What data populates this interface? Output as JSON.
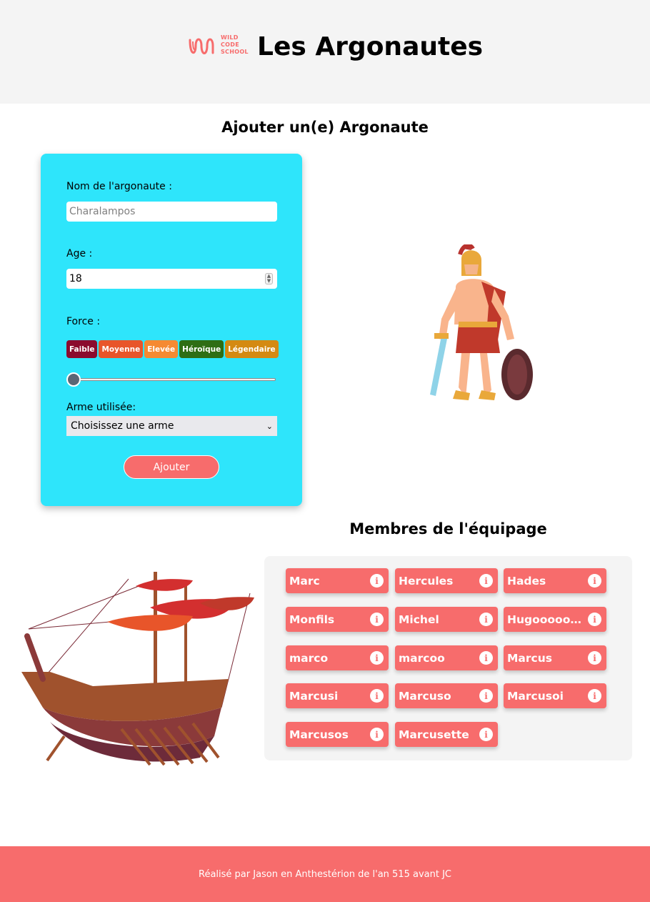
{
  "header": {
    "logo_lines": [
      "WILD",
      "CODE",
      "SCHOOL"
    ],
    "title": "Les Argonautes"
  },
  "form": {
    "title": "Ajouter un(e) Argonaute",
    "name_label": "Nom de l'argonaute :",
    "name_placeholder": "Charalampos",
    "age_label": "Age :",
    "age_value": "18",
    "force_label": "Force :",
    "force_levels": [
      {
        "label": "Faible",
        "color": "#8b0b2e"
      },
      {
        "label": "Moyenne",
        "color": "#e8552a"
      },
      {
        "label": "Elevée",
        "color": "#f58a32"
      },
      {
        "label": "Héroïque",
        "color": "#2e6e14"
      },
      {
        "label": "Légendaire",
        "color": "#d48a12"
      }
    ],
    "force_slider_level": 0,
    "weapon_label": "Arme utilisée:",
    "weapon_selected": "Choisissez une arme",
    "submit_label": "Ajouter"
  },
  "crew": {
    "title": "Membres de l'équipage",
    "members": [
      "Marc",
      "Hercules",
      "Hades",
      "Monfils",
      "Michel",
      "Hugoooooooo",
      "marco",
      "marcoo",
      "Marcus",
      "Marcusi",
      "Marcuso",
      "Marcusoi",
      "Marcusos",
      "Marcusette"
    ]
  },
  "footer": {
    "text": "Réalisé par Jason en Anthestérion de l'an 515 avant JC"
  },
  "colors": {
    "accent": "#f76c6c",
    "form_bg": "#2ee5fb",
    "header_bg": "#f4f4f4"
  }
}
